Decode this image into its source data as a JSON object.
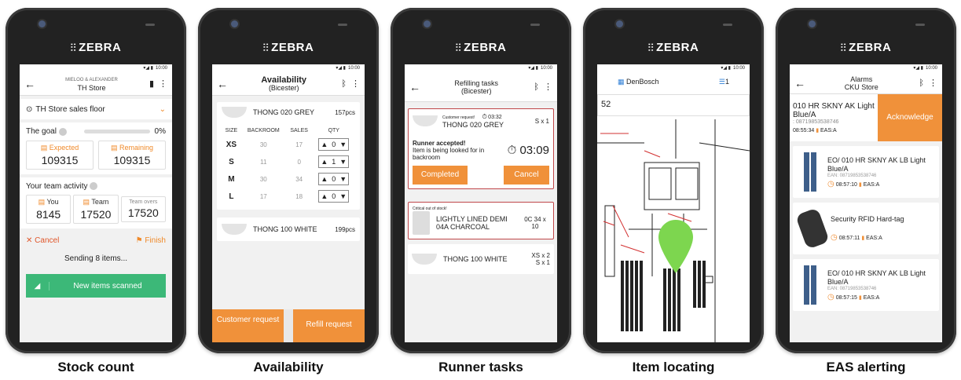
{
  "phones": {
    "brand": "ZEBRA",
    "status_time": "10:00"
  },
  "captions": [
    "Stock count",
    "Availability",
    "Runner tasks",
    "Item locating",
    "EAS alerting"
  ],
  "stock": {
    "header_brand": "MIELOO & ALEXANDER",
    "header_title": "TH Store",
    "location": "TH Store sales floor",
    "goal_label": "The goal",
    "goal_pct": "0%",
    "goal_progress": 0,
    "expected_label": "Expected",
    "expected_value": "109315",
    "remaining_label": "Remaining",
    "remaining_value": "109315",
    "team_activity_label": "Your team activity",
    "you_label": "You",
    "you_value": "8145",
    "team_label": "Team",
    "team_value": "17520",
    "overs_label": "Team overs",
    "overs_value": "17520",
    "cancel_label": "Cancel",
    "finish_label": "Finish",
    "sending_text": "Sending 8 items...",
    "scan_label": "New items scanned"
  },
  "availability": {
    "title": "Availability",
    "subtitle": "(Bicester)",
    "item1_name": "THONG 020 GREY",
    "item1_qty": "157pcs",
    "headers": [
      "SIZE",
      "BACKROOM",
      "SALES",
      "QTY"
    ],
    "rows": [
      {
        "size": "XS",
        "backroom": "30",
        "sales": "17",
        "qty": "0"
      },
      {
        "size": "S",
        "backroom": "11",
        "sales": "0",
        "qty": "1"
      },
      {
        "size": "M",
        "backroom": "30",
        "sales": "34",
        "qty": "0"
      },
      {
        "size": "L",
        "backroom": "17",
        "sales": "18",
        "qty": "0"
      }
    ],
    "item2_name": "THONG 100 WHITE",
    "item2_qty": "199pcs",
    "customer_btn": "Customer request",
    "refill_btn": "Refill request"
  },
  "runner": {
    "title": "Refilling tasks",
    "subtitle": "(Bicester)",
    "task1_tag": "Customer request!",
    "task1_time": "03:32",
    "task1_name": "THONG 020 GREY",
    "task1_qty": "S x 1",
    "accepted_title": "Runner accepted!",
    "accepted_text": "Item is being looked for in backroom",
    "timer": "03:09",
    "completed_btn": "Completed",
    "cancel_btn": "Cancel",
    "task2_tag": "Critical out of stock!",
    "task2_name": "LIGHTLY LINED DEMI 04A CHARCOAL",
    "task2_qty": "0C 34 x 10",
    "task3_name": "THONG 100 WHITE",
    "task3_qty": "XS x 2 S x 1"
  },
  "locating": {
    "store": "DenBosch",
    "list_count": "1",
    "search_value": "52"
  },
  "eas": {
    "title": "Alarms",
    "subtitle": "CKU Store",
    "top_name": "010 HR SKNY AK Light Blue/A",
    "top_ean": ": 08719853538746",
    "top_time": "08:55:34",
    "top_tag": "EAS:A",
    "ack_btn": "Acknowledge",
    "items": [
      {
        "name": "EO/ 010 HR SKNY AK LB Light Blue/A",
        "ean": "EAN: 08719853538746",
        "time": "08:57:10",
        "tag": "EAS:A",
        "kind": "jeans"
      },
      {
        "name": "Security RFID Hard-tag",
        "ean": "",
        "time": "08:57:11",
        "tag": "EAS:A",
        "kind": "tag"
      },
      {
        "name": "EO/ 010 HR SKNY AK LB Light Blue/A",
        "ean": "EAN: 08719853538746",
        "time": "08:57:15",
        "tag": "EAS:A",
        "kind": "jeans"
      }
    ]
  },
  "colors": {
    "accent": "#f08a2a",
    "green": "#3cb878",
    "blue": "#2f7fd6",
    "pin": "#7dd64f"
  }
}
